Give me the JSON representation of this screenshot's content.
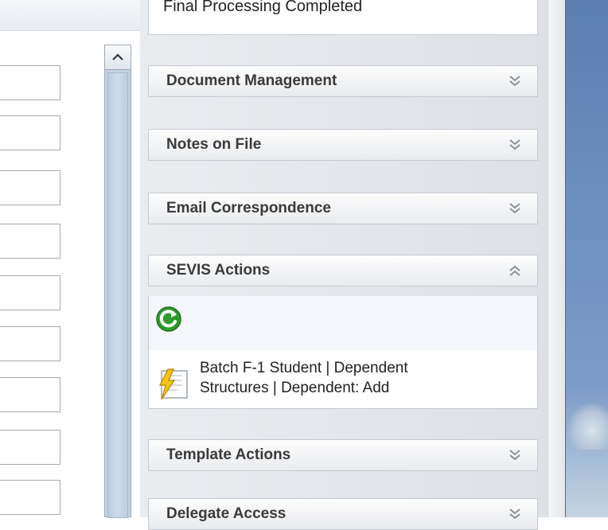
{
  "status_box": {
    "text": "Final Processing Completed"
  },
  "accordion": {
    "document_management": {
      "label": "Document Management",
      "state": "collapsed"
    },
    "notes_on_file": {
      "label": "Notes on File",
      "state": "collapsed"
    },
    "email_correspondence": {
      "label": "Email Correspondence",
      "state": "collapsed"
    },
    "sevis_actions": {
      "label": "SEVIS Actions",
      "state": "expanded",
      "refresh_icon": "refresh-icon",
      "action_line1": "Batch F-1 Student | Dependent",
      "action_line2": "Structures | Dependent: Add",
      "action_icon": "lightning-document-icon"
    },
    "template_actions": {
      "label": "Template Actions",
      "state": "collapsed"
    },
    "delegate_access": {
      "label": "Delegate Access",
      "state": "collapsed"
    }
  },
  "colors": {
    "refresh_green": "#2f9a2a",
    "header_text": "#3a3a3a",
    "chevron": "#8a8f96",
    "desktop_blue": "#6c8fbf"
  }
}
